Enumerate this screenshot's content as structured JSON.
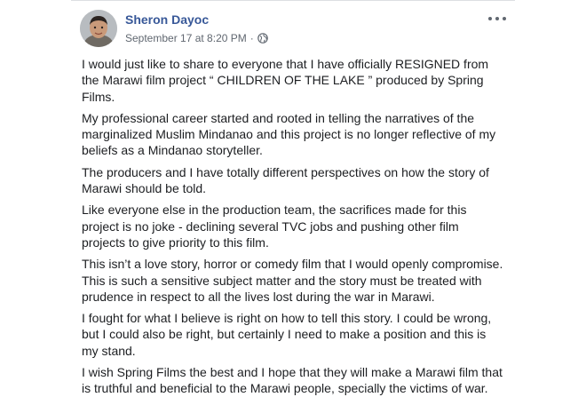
{
  "post": {
    "author": "Sheron Dayoc",
    "timestamp": "September 17 at 8:20 PM",
    "separator": "·",
    "privacy_icon": "globe-icon",
    "more_icon": "more-horizontal-icon",
    "paragraphs": [
      "I would just like to share to everyone that I have officially RESIGNED from the Marawi film project “ CHILDREN OF THE LAKE ” produced by Spring Films.",
      "My professional career started and rooted in telling the narratives of the marginalized Muslim Mindanao and this project is no longer reflective of my beliefs as a Mindanao storyteller.",
      "The producers and I have totally different perspectives on how the story of Marawi should be told.",
      "Like everyone else in the production team, the sacrifices made for this project is no joke - declining several TVC jobs and pushing other film projects to give priority to this film.",
      "This isn’t a love story, horror or comedy film that I would openly compromise. This is such a sensitive subject matter and the story must be treated with prudence in respect to all the lives lost during the war in Marawi.",
      "I fought for what I believe is right on how to tell this story. I could be wrong, but I could also be right, but certainly I need to make a position and this is my stand.",
      "I wish Spring Films the best and I hope that they will make a Marawi film that is truthful and beneficial to the Marawi people, specially the victims of war."
    ]
  },
  "colors": {
    "author_link": "#385898",
    "meta_text": "#606770",
    "body_text": "#1c1e21",
    "background": "#ffffff"
  }
}
